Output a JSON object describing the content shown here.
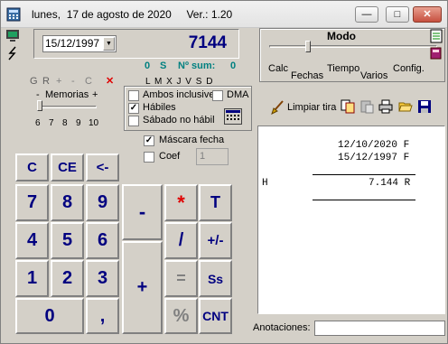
{
  "window": {
    "title": "lunes,  17 de agosto de 2020     Ver.: 1.20"
  },
  "titlebar_buttons": {
    "min": "—",
    "max": "□",
    "close": "✕"
  },
  "date_combo": {
    "value": "15/12/1997"
  },
  "display": {
    "value": "7144"
  },
  "status": {
    "o": "0",
    "s": "S",
    "n_sum_label": "Nº sum:",
    "n_sum": "0"
  },
  "memory": {
    "g": "G",
    "r": "R",
    "plus": "+",
    "minus": "-",
    "c": "C",
    "x": "✕",
    "label": "Memorias",
    "m_minus": "-",
    "m_plus": "+",
    "ticks": [
      "6",
      "7",
      "8",
      "9",
      "10"
    ]
  },
  "days": {
    "header": "L M X J V S D",
    "ambos": "Ambos inclusive",
    "dma": "DMA",
    "habiles": "Hábiles",
    "sabado": "Sábado no hábil"
  },
  "options": {
    "mascara": "Máscara fecha",
    "coef": "Coef",
    "coef_value": "1"
  },
  "modo": {
    "title": "Modo",
    "labels": [
      "Calc",
      "Fechas",
      "Tiempo",
      "Varios",
      "Config."
    ]
  },
  "limpiar": {
    "label": "Limpiar tira"
  },
  "tape": {
    "lines": [
      "12/10/2020 F",
      "15/12/1997 F",
      "H",
      "7.144 R"
    ]
  },
  "anotaciones": {
    "label": "Anotaciones:",
    "value": ""
  },
  "keys": {
    "c": "C",
    "ce": "CE",
    "back": "<-",
    "k7": "7",
    "k8": "8",
    "k9": "9",
    "k4": "4",
    "k5": "5",
    "k6": "6",
    "k1": "1",
    "k2": "2",
    "k3": "3",
    "k0": "0",
    "comma": ",",
    "minus": "-",
    "plus": "+",
    "mul": "*",
    "div": "/",
    "eq": "=",
    "pct": "%",
    "t": "T",
    "pm": "+/-",
    "ss": "Ss",
    "cnt": "CNT"
  }
}
